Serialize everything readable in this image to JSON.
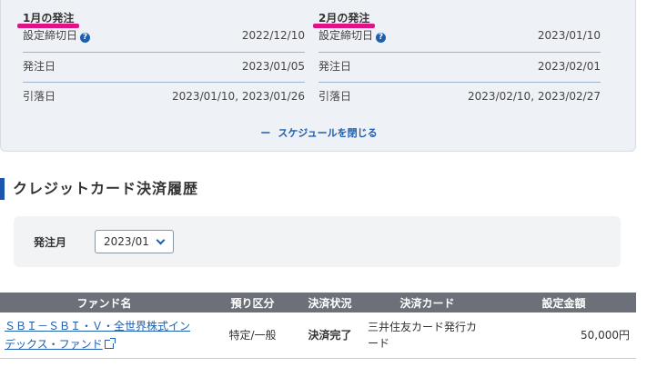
{
  "schedule": {
    "months": [
      {
        "title": "1月の発注",
        "rows": [
          {
            "label": "設定締切日",
            "help": true,
            "value": "2022/12/10"
          },
          {
            "label": "発注日",
            "help": false,
            "value": "2023/01/05"
          },
          {
            "label": "引落日",
            "help": false,
            "value": "2023/01/10, 2023/01/26"
          }
        ]
      },
      {
        "title": "2月の発注",
        "rows": [
          {
            "label": "設定締切日",
            "help": true,
            "value": "2023/01/10"
          },
          {
            "label": "発注日",
            "help": false,
            "value": "2023/02/01"
          },
          {
            "label": "引落日",
            "help": false,
            "value": "2023/02/10, 2023/02/27"
          }
        ]
      }
    ],
    "help_glyph": "?",
    "close_minus": "ー",
    "close_label": "スケジュールを閉じる"
  },
  "section_title": "クレジットカード決済履歴",
  "filter": {
    "label": "発注月",
    "selected": "2023/01"
  },
  "table": {
    "headers": [
      "ファンド名",
      "預り区分",
      "決済状況",
      "決済カード",
      "設定金額"
    ],
    "rows": [
      {
        "fund_line1": "ＳＢＩ－ＳＢＩ・Ｖ・全世界株式イン",
        "fund_line2": "デックス・ファンド",
        "account": "特定/一般",
        "status": "決済完了",
        "card_line1": "三井住友カード発行カ",
        "card_line2": "ード",
        "amount": "50,000円"
      }
    ]
  },
  "colors": {
    "accent_blue": "#1f5fb0",
    "highlight_pink": "#e0128a",
    "header_gray": "#6b7079"
  }
}
